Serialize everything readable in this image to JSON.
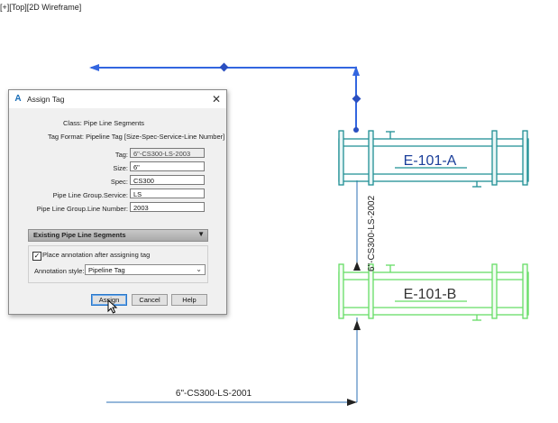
{
  "viewport": {
    "label": "[+][Top][2D Wireframe]"
  },
  "drawing": {
    "pipe_label_vertical": "6\"-CS300-LS-2002",
    "pipe_label_horizontal": "6\"-CS300-LS-2001",
    "equipment_a": "E-101-A",
    "equipment_b": "E-101-B",
    "colors": {
      "selected_pipe": "#3366e0",
      "equip_a": "#1f8f95",
      "equip_b": "#66dd66",
      "pipe": "#2b6fb5"
    }
  },
  "dialog": {
    "title": "Assign Tag",
    "class_text": "Class: Pipe Line Segments",
    "format_text": "Tag Format: Pipeline Tag [Size-Spec-Service-Line Number]",
    "fields": [
      {
        "label": "Tag:",
        "value": "6\"-CS300-LS-2003",
        "readonly": true
      },
      {
        "label": "Size:",
        "value": "6\""
      },
      {
        "label": "Spec:",
        "value": "CS300"
      },
      {
        "label": "Pipe Line Group.Service:",
        "value": "LS"
      },
      {
        "label": "Pipe Line Group.Line Number:",
        "value": "2003"
      }
    ],
    "section_title": "Existing Pipe Line Segments",
    "checkbox_label": "Place annotation after assigning tag",
    "checkbox_checked": "✓",
    "annotation_style_label": "Annotation style:",
    "annotation_style_value": "Pipeline Tag",
    "buttons": {
      "assign": "Assign",
      "cancel": "Cancel",
      "help": "Help"
    }
  }
}
